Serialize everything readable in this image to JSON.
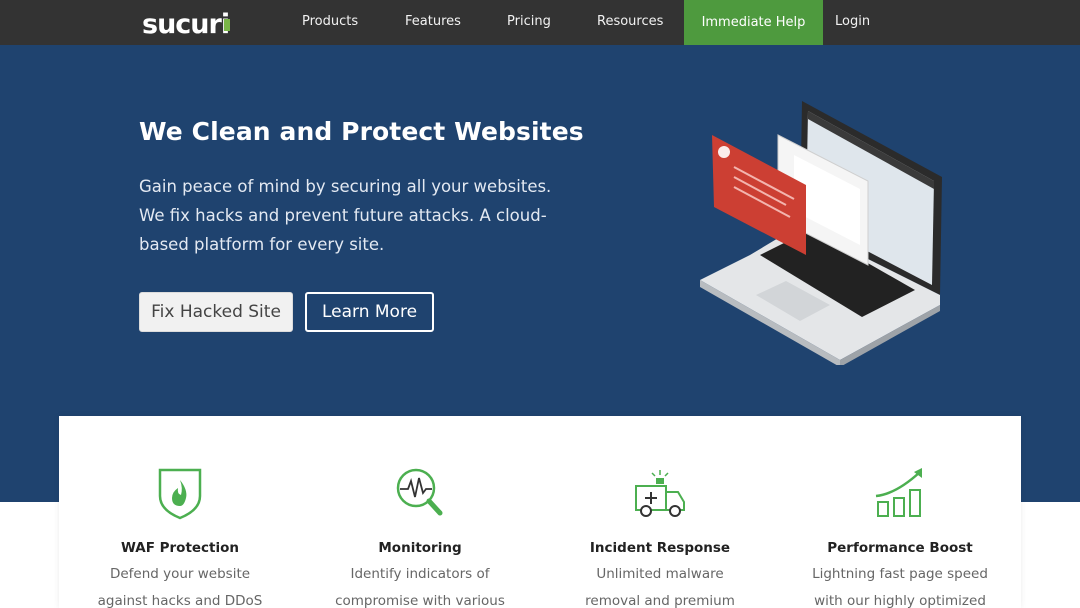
{
  "nav": {
    "logo_text": "sucuri",
    "items": [
      {
        "label": "Products"
      },
      {
        "label": "Features"
      },
      {
        "label": "Pricing"
      },
      {
        "label": "Resources"
      }
    ],
    "help_label": "Immediate Help",
    "login_label": "Login"
  },
  "hero": {
    "title": "We Clean and Protect Websites",
    "description": "Gain peace of mind by securing all your websites. We fix hacks and prevent future attacks. A cloud-based platform for every site.",
    "primary_button": "Fix Hacked Site",
    "secondary_button": "Learn More"
  },
  "features": [
    {
      "title": "WAF Protection",
      "desc_line1": "Defend your website",
      "desc_line2": "against hacks and DDoS",
      "icon": "shield-flame-icon"
    },
    {
      "title": "Monitoring",
      "desc_line1": "Identify indicators of",
      "desc_line2": "compromise with various",
      "icon": "magnifier-pulse-icon"
    },
    {
      "title": "Incident Response",
      "desc_line1": "Unlimited malware",
      "desc_line2": "removal and premium",
      "icon": "ambulance-icon"
    },
    {
      "title": "Performance Boost",
      "desc_line1": "Lightning fast page speed",
      "desc_line2": "with our highly optimized",
      "icon": "growth-chart-icon"
    }
  ],
  "colors": {
    "nav_bg": "#333333",
    "help_green": "#4e9a3e",
    "hero_blue": "#1f436f",
    "icon_green": "#4caf50"
  }
}
